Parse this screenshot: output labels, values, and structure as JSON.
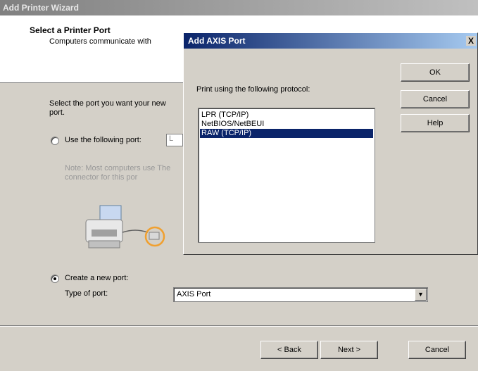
{
  "wizard": {
    "title": "Add Printer Wizard",
    "header_title": "Select a Printer Port",
    "header_subtitle": "Computers communicate with",
    "body_text": "Select the port you want your new port.",
    "use_port_label": "Use the following port:",
    "use_port_value": "L",
    "note_text": "Note: Most computers use The connector for this por",
    "create_port_label": "Create a new port:",
    "type_of_port_label": "Type of port:",
    "type_of_port_value": "AXIS Port",
    "selected_option": "create",
    "back_label": "< Back",
    "next_label": "Next >",
    "cancel_label": "Cancel"
  },
  "axis_dialog": {
    "title": "Add AXIS Port",
    "close_label": "X",
    "protocol_label": "Print using the following protocol:",
    "protocols": [
      "LPR (TCP/IP)",
      "NetBIOS/NetBEUI",
      "RAW (TCP/IP)"
    ],
    "selected_protocol": "RAW (TCP/IP)",
    "ok_label": "OK",
    "cancel_label": "Cancel",
    "help_label": "Help"
  },
  "colors": {
    "dialog_face": "#d4d0c8",
    "active_title": "#0a246a",
    "inactive_title": "#808080",
    "selection": "#0a246a",
    "printer_highlight": "#f0a030"
  },
  "icons": [
    "printer-icon",
    "port-connector-icon",
    "dropdown-arrow-icon",
    "close-icon"
  ]
}
